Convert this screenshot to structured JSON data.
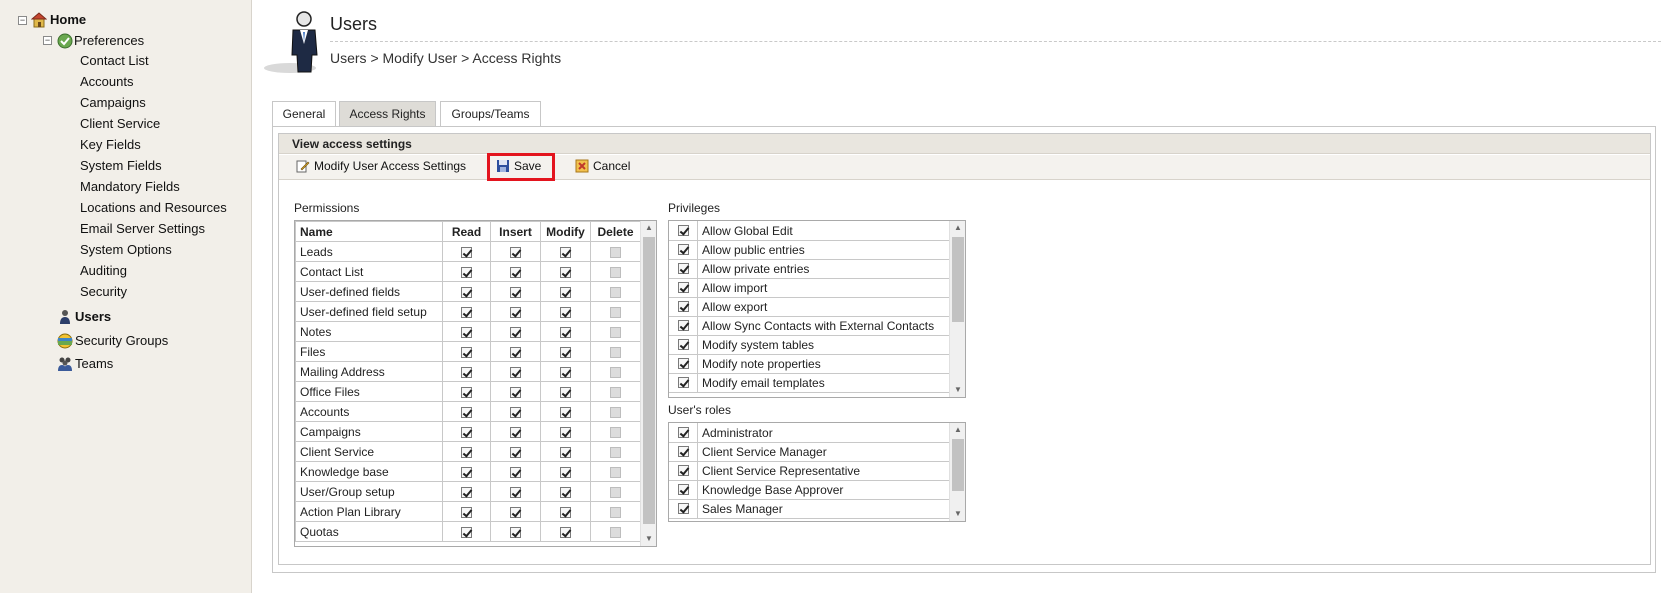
{
  "sidebar": {
    "home": "Home",
    "preferences": "Preferences",
    "preferences_items": [
      "Contact List",
      "Accounts",
      "Campaigns",
      "Client Service",
      "Key Fields",
      "System Fields",
      "Mandatory Fields",
      "Locations and Resources",
      "Email Server Settings",
      "System Options",
      "Auditing",
      "Security"
    ],
    "users": "Users",
    "security_groups": "Security Groups",
    "teams": "Teams"
  },
  "header": {
    "title": "Users",
    "breadcrumb": "Users > Modify User > Access Rights"
  },
  "tabs": [
    {
      "label": "General"
    },
    {
      "label": "Access Rights"
    },
    {
      "label": "Groups/Teams"
    }
  ],
  "panel": {
    "title": "View access settings"
  },
  "toolbar": {
    "modify_label": "Modify User Access Settings",
    "save_label": "Save",
    "cancel_label": "Cancel"
  },
  "permissions": {
    "label": "Permissions",
    "columns": [
      "Name",
      "Read",
      "Insert",
      "Modify",
      "Delete"
    ],
    "rows": [
      {
        "name": "Leads",
        "read": true,
        "insert": true,
        "modify": true,
        "delete": false
      },
      {
        "name": "Contact List",
        "read": true,
        "insert": true,
        "modify": true,
        "delete": false
      },
      {
        "name": "User-defined fields",
        "read": true,
        "insert": true,
        "modify": true,
        "delete": false
      },
      {
        "name": "User-defined field setup",
        "read": true,
        "insert": true,
        "modify": true,
        "delete": false
      },
      {
        "name": "Notes",
        "read": true,
        "insert": true,
        "modify": true,
        "delete": false
      },
      {
        "name": "Files",
        "read": true,
        "insert": true,
        "modify": true,
        "delete": false
      },
      {
        "name": "Mailing Address",
        "read": true,
        "insert": true,
        "modify": true,
        "delete": false
      },
      {
        "name": "Office Files",
        "read": true,
        "insert": true,
        "modify": true,
        "delete": false
      },
      {
        "name": "Accounts",
        "read": true,
        "insert": true,
        "modify": true,
        "delete": false
      },
      {
        "name": "Campaigns",
        "read": true,
        "insert": true,
        "modify": true,
        "delete": false
      },
      {
        "name": "Client Service",
        "read": true,
        "insert": true,
        "modify": true,
        "delete": false
      },
      {
        "name": "Knowledge base",
        "read": true,
        "insert": true,
        "modify": true,
        "delete": false
      },
      {
        "name": "User/Group setup",
        "read": true,
        "insert": true,
        "modify": true,
        "delete": false
      },
      {
        "name": "Action Plan Library",
        "read": true,
        "insert": true,
        "modify": true,
        "delete": false
      },
      {
        "name": "Quotas",
        "read": true,
        "insert": true,
        "modify": true,
        "delete": false
      }
    ]
  },
  "privileges": {
    "label": "Privileges",
    "items": [
      "Allow Global Edit",
      "Allow public entries",
      "Allow private entries",
      "Allow import",
      "Allow export",
      "Allow Sync Contacts with External Contacts",
      "Modify system tables",
      "Modify note properties",
      "Modify email templates"
    ]
  },
  "roles": {
    "label": "User's roles",
    "items": [
      "Administrator",
      "Client Service Manager",
      "Client Service Representative",
      "Knowledge Base Approver",
      "Sales Manager"
    ]
  },
  "colors": {
    "save_highlight": "#e3141e",
    "sidebar_bg": "#f2efe9",
    "active_tab": "#dedcd7"
  }
}
